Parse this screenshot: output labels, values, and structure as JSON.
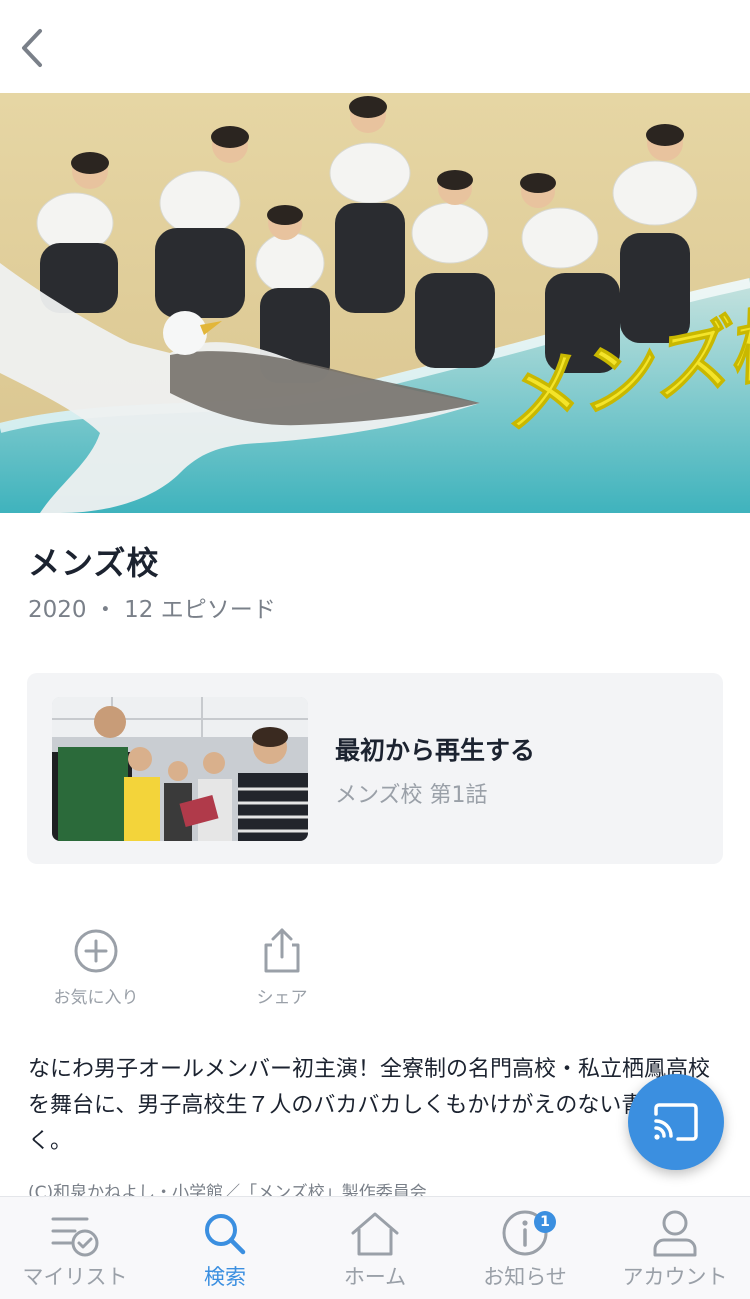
{
  "header": {
    "back_icon": "chevron-left-icon"
  },
  "show": {
    "hero_logo_text": "メンズ校",
    "title": "メンズ校",
    "meta": "2020 ・ 12 エピソード"
  },
  "play_card": {
    "title": "最初から再生する",
    "subtitle": "メンズ校 第1話"
  },
  "actions": {
    "favorite_label": "お気に入り",
    "share_label": "シェア"
  },
  "description": "なにわ男子オールメンバー初主演！全寮制の名門高校・私立栖鳳高校を舞台に、男子高校生７人のバカバカしくもかけがえのない青春を描く。",
  "copyright": "(C)和泉かねよし・小学館／「メンズ校」製作委員会",
  "tabs": [
    {
      "label": "マイリスト",
      "icon": "mylist-icon"
    },
    {
      "label": "検索",
      "icon": "search-icon"
    },
    {
      "label": "ホーム",
      "icon": "home-icon"
    },
    {
      "label": "お知らせ",
      "icon": "info-icon",
      "badge": "1"
    },
    {
      "label": "アカウント",
      "icon": "account-icon"
    }
  ],
  "colors": {
    "accent": "#3b8fe0",
    "logo_yellow": "#f4e42a"
  }
}
